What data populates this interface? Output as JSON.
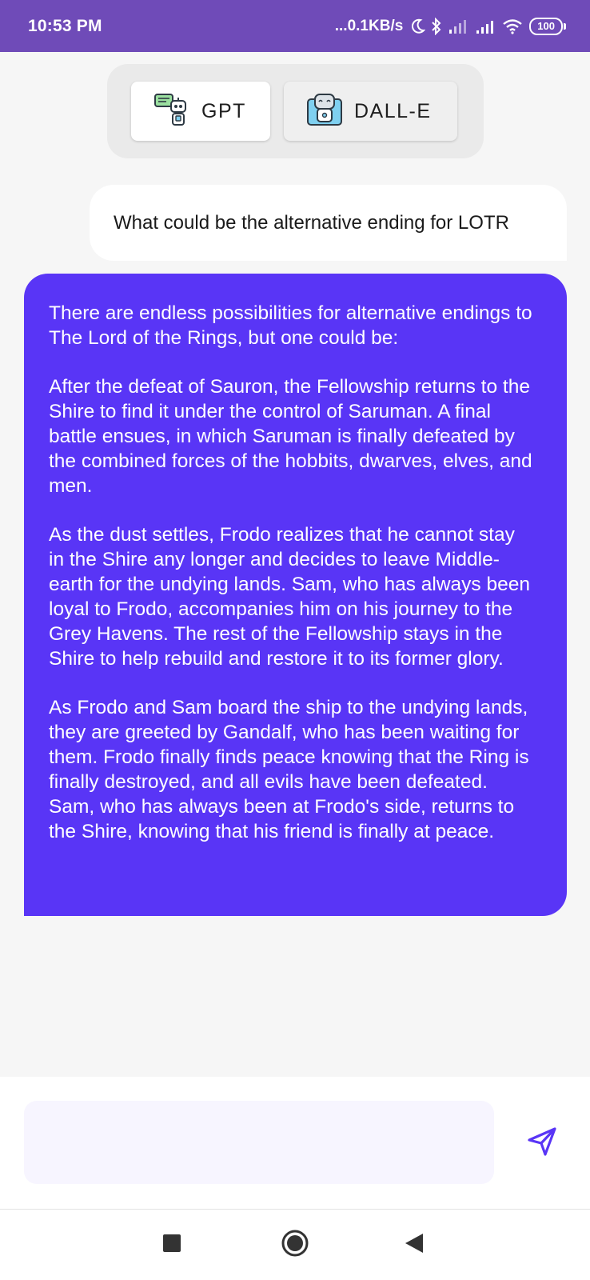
{
  "status_bar": {
    "time": "10:53 PM",
    "network_speed": "...0.1KB/s",
    "battery": "100",
    "icons": [
      "moon-icon",
      "bluetooth-icon",
      "signal-icon-1",
      "signal-icon-2",
      "wifi-icon",
      "battery-icon"
    ]
  },
  "model_selector": {
    "gpt_label": "GPT",
    "dalle_label": "DALL-E",
    "selected": "GPT"
  },
  "chat": {
    "user_message": "What could be the alternative ending for LOTR",
    "bot_paragraphs": [
      "There are endless possibilities for alternative endings to The Lord of the Rings, but one could be:",
      "After the defeat of Sauron, the Fellowship returns to the Shire to find it under the control of Saruman. A final battle ensues, in which Saruman is finally defeated by the combined forces of the hobbits, dwarves, elves, and men.",
      "As the dust settles, Frodo realizes that he cannot stay in the Shire any longer and decides to leave Middle-earth for the undying lands. Sam, who has always been loyal to Frodo, accompanies him on his journey to the Grey Havens. The rest of the Fellowship stays in the Shire to help rebuild and restore it to its former glory.",
      "As Frodo and Sam board the ship to the undying lands, they are greeted by Gandalf, who has been waiting for them. Frodo finally finds peace knowing that the Ring is finally destroyed, and all evils have been defeated. Sam, who has always been at Frodo's side, returns to the Shire, knowing that his friend is finally at peace."
    ]
  },
  "input": {
    "value": "",
    "placeholder": ""
  },
  "colors": {
    "status_bar": "#6F4BB8",
    "accent": "#5935F6",
    "background": "#F6F6F6"
  }
}
